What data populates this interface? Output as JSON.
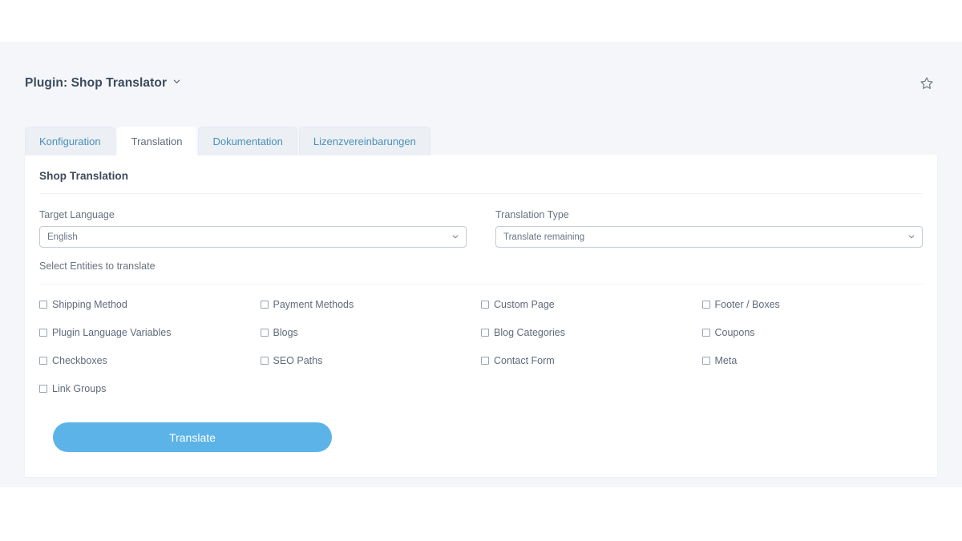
{
  "header": {
    "title": "Plugin: Shop Translator",
    "title_caret_icon": "chevron-down-icon",
    "favorite_icon": "star-outline-icon"
  },
  "tabs": [
    {
      "label": "Konfiguration",
      "active": false
    },
    {
      "label": "Translation",
      "active": true
    },
    {
      "label": "Dokumentation",
      "active": false
    },
    {
      "label": "Lizenzvereinbarungen",
      "active": false
    }
  ],
  "card": {
    "title": "Shop Translation",
    "fields": [
      {
        "label": "Target Language",
        "value": "English",
        "chevron_icon": "chevron-down-icon"
      },
      {
        "label": "Translation Type",
        "value": "Translate remaining",
        "chevron_icon": "chevron-down-icon"
      }
    ],
    "entities_label": "Select Entities to translate",
    "entities": [
      {
        "label": "Shipping Method",
        "checked": false
      },
      {
        "label": "Payment Methods",
        "checked": false
      },
      {
        "label": "Custom Page",
        "checked": false
      },
      {
        "label": "Footer / Boxes",
        "checked": false
      },
      {
        "label": "Plugin Language Variables",
        "checked": false
      },
      {
        "label": "Blogs",
        "checked": false
      },
      {
        "label": "Blog Categories",
        "checked": false
      },
      {
        "label": "Coupons",
        "checked": false
      },
      {
        "label": "Checkboxes",
        "checked": false
      },
      {
        "label": "SEO Paths",
        "checked": false
      },
      {
        "label": "Contact Form",
        "checked": false
      },
      {
        "label": "Meta",
        "checked": false
      },
      {
        "label": "Link Groups",
        "checked": false
      }
    ],
    "submit_label": "Translate"
  },
  "colors": {
    "page_background": "#f4f6fa",
    "card_background": "#ffffff",
    "tab_inactive_background": "#eceff4",
    "tab_inactive_text": "#4a90b9",
    "tab_active_text": "#5e6b7b",
    "accent_button": "#5cb3e8",
    "title_text": "#3c4a5b",
    "label_text": "#67737f"
  }
}
